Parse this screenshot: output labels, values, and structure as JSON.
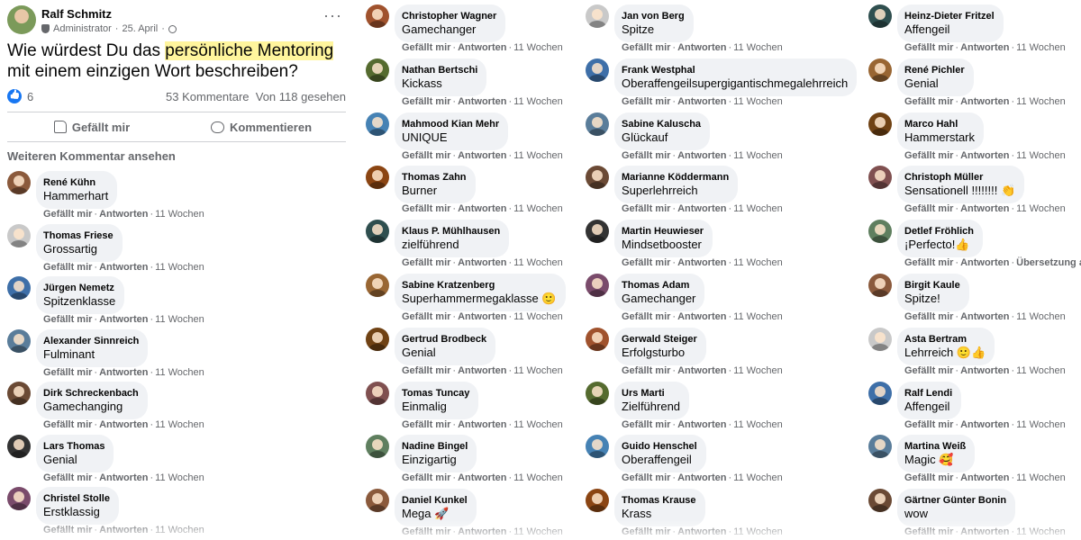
{
  "post": {
    "author": "Ralf Schmitz",
    "role": "Administrator",
    "date": "25. April",
    "more_label": "···",
    "text_before": "Wie würdest Du das ",
    "text_highlight": "persönliche Mentoring",
    "text_after": " mit einem einzigen Wort beschreiben?",
    "reaction_count": "6",
    "comments_count": "53 Kommentare",
    "seen_by": "Von 118 gesehen",
    "like_label": "Gefällt mir",
    "comment_label": "Kommentieren",
    "more_comments_label": "Weiteren Kommentar ansehen"
  },
  "labels": {
    "like": "Gefällt mir",
    "reply": "Antworten",
    "translation": "Übersetzung an",
    "sep": "·"
  },
  "colors": {
    "accent": "#1877f2",
    "highlight": "#fff59d",
    "bubble": "#f0f2f5",
    "meta": "#65676b"
  },
  "columns": [
    [
      {
        "name": "René Kühn",
        "text": "Hammerhart",
        "time": "11 Wochen"
      },
      {
        "name": "Thomas Friese",
        "text": "Grossartig",
        "time": "11 Wochen"
      },
      {
        "name": "Jürgen Nemetz",
        "text": "Spitzenklasse",
        "time": "11 Wochen"
      },
      {
        "name": "Alexander Sinnreich",
        "text": "Fulminant",
        "time": "11 Wochen"
      },
      {
        "name": "Dirk Schreckenbach",
        "text": "Gamechanging",
        "time": "11 Wochen"
      },
      {
        "name": "Lars Thomas",
        "text": "Genial",
        "time": "11 Wochen"
      },
      {
        "name": "Christel Stolle",
        "text": "Erstklassig",
        "time": "11 Wochen"
      }
    ],
    [
      {
        "name": "Christopher Wagner",
        "text": "Gamechanger",
        "time": "11 Wochen"
      },
      {
        "name": "Nathan Bertschi",
        "text": "Kickass",
        "time": "11 Wochen"
      },
      {
        "name": "Mahmood Kian Mehr",
        "text": "UNIQUE",
        "time": "11 Wochen"
      },
      {
        "name": "Thomas Zahn",
        "text": "Burner",
        "time": "11 Wochen"
      },
      {
        "name": "Klaus P. Mühlhausen",
        "text": "zielführend",
        "time": "11 Wochen"
      },
      {
        "name": "Sabine Kratzenberg",
        "text": "Superhammermegaklasse 🙂",
        "time": "11 Wochen"
      },
      {
        "name": "Gertrud Brodbeck",
        "text": "Genial",
        "time": "11 Wochen"
      },
      {
        "name": "Tomas Tuncay",
        "text": "Einmalig",
        "time": "11 Wochen"
      },
      {
        "name": "Nadine Bingel",
        "text": "Einzigartig",
        "time": "11 Wochen"
      },
      {
        "name": "Daniel Kunkel",
        "text": "Mega 🚀",
        "time": "11 Wochen"
      }
    ],
    [
      {
        "name": "Jan von Berg",
        "text": "Spitze",
        "time": "11 Wochen"
      },
      {
        "name": "Frank Westphal",
        "text": "Oberaffengeilsupergigantischmegalehrreich",
        "time": "11 Wochen"
      },
      {
        "name": "Sabine Kaluscha",
        "text": "Glückauf",
        "time": "11 Wochen"
      },
      {
        "name": "Marianne Köddermann",
        "text": "Superlehrreich",
        "time": "11 Wochen"
      },
      {
        "name": "Martin Heuwieser",
        "text": "Mindsetbooster",
        "time": "11 Wochen"
      },
      {
        "name": "Thomas Adam",
        "text": "Gamechanger",
        "time": "11 Wochen"
      },
      {
        "name": "Gerwald Steiger",
        "text": "Erfolgsturbo",
        "time": "11 Wochen"
      },
      {
        "name": "Urs Marti",
        "text": "Zielführend",
        "time": "11 Wochen"
      },
      {
        "name": "Guido Henschel",
        "text": "Oberaffengeil",
        "time": "11 Wochen"
      },
      {
        "name": "Thomas Krause",
        "text": "Krass",
        "time": "11 Wochen"
      }
    ],
    [
      {
        "name": "Heinz-Dieter Fritzel",
        "text": "Affengeil",
        "time": "11 Wochen"
      },
      {
        "name": "René Pichler",
        "text": "Genial",
        "time": "11 Wochen"
      },
      {
        "name": "Marco Hahl",
        "text": "Hammerstark",
        "time": "11 Wochen"
      },
      {
        "name": "Christoph Müller",
        "text": "Sensationell !!!!!!!! 👏",
        "time": "11 Wochen"
      },
      {
        "name": "Detlef Fröhlich",
        "text": "¡Perfecto!👍",
        "time": "",
        "translation": true
      },
      {
        "name": "Birgit Kaule",
        "text": "Spitze!",
        "time": "11 Wochen"
      },
      {
        "name": "Asta Bertram",
        "text": "Lehrreich 🙂👍",
        "time": "11 Wochen"
      },
      {
        "name": "Ralf Lendi",
        "text": "Affengeil",
        "time": "11 Wochen"
      },
      {
        "name": "Martina Weiß",
        "text": "Magic 🥰",
        "time": "11 Wochen"
      },
      {
        "name": "Gärtner Günter Bonin",
        "text": "wow",
        "time": "11 Wochen"
      }
    ]
  ]
}
